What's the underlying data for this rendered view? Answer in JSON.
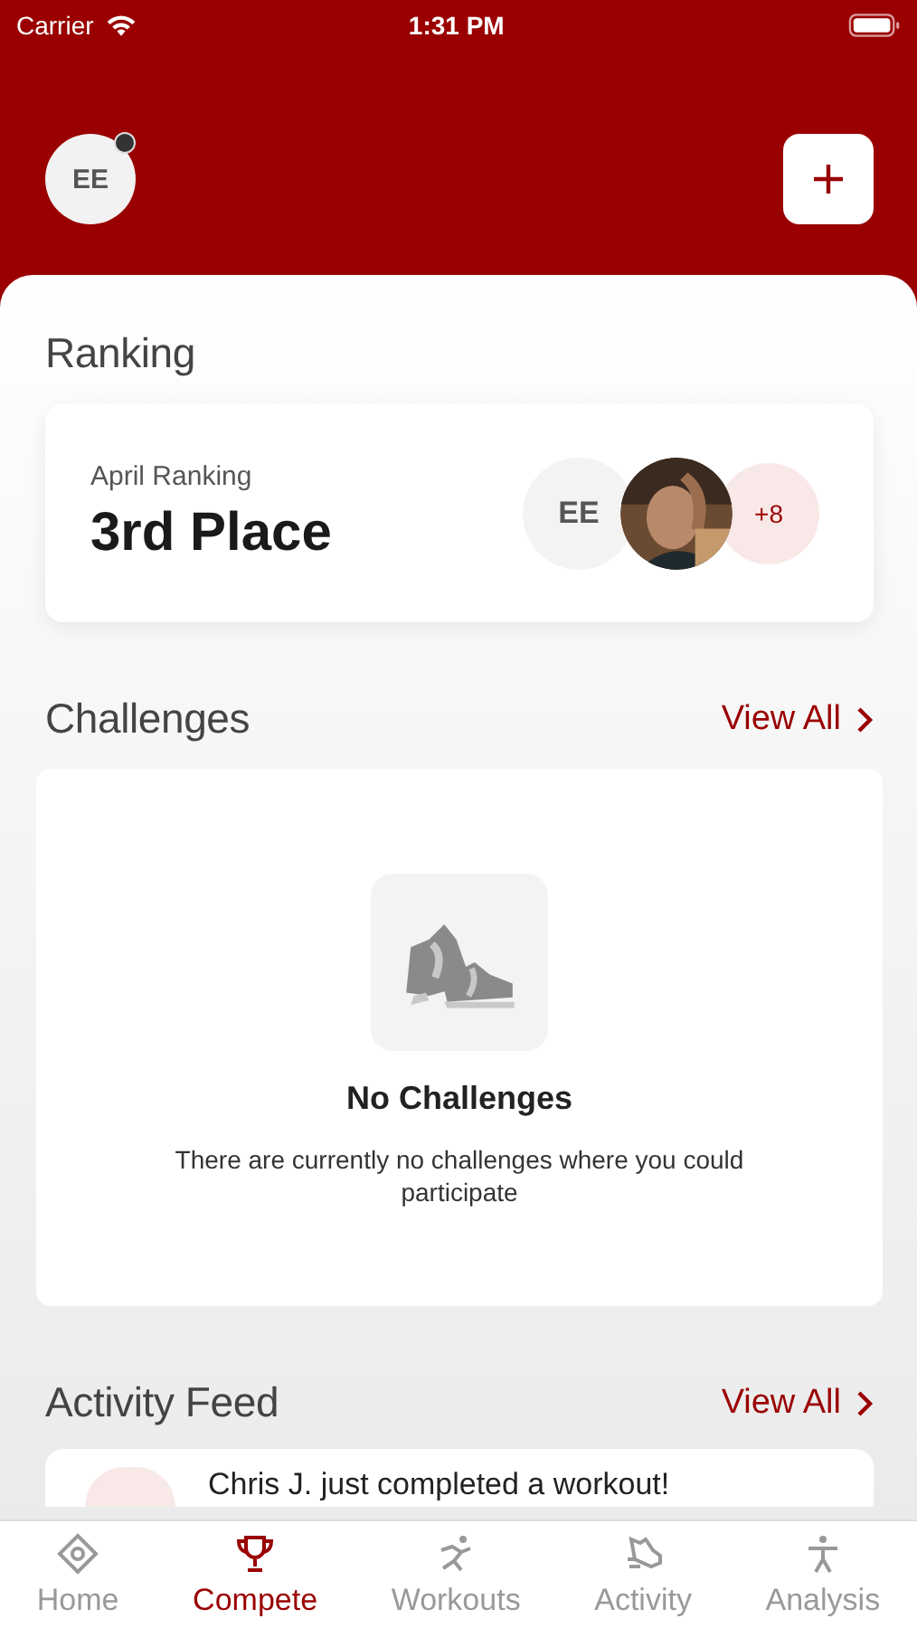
{
  "status_bar": {
    "carrier": "Carrier",
    "time": "1:31 PM"
  },
  "header": {
    "avatar": "EE",
    "notification_dot": true
  },
  "ranking": {
    "title": "Ranking",
    "label": "April Ranking",
    "place": "3rd Place",
    "participants": [
      {
        "kind": "initials",
        "text": "EE"
      },
      {
        "kind": "picture"
      },
      {
        "kind": "more",
        "text": "+8"
      }
    ]
  },
  "challenges": {
    "title": "Challenges",
    "view_all": "View All",
    "empty_title": "No Challenges",
    "empty_text": "There are currently no challenges where you could participate"
  },
  "activity_feed": {
    "title": "Activity Feed",
    "view_all": "View All",
    "items": [
      {
        "text": "Chris J. just completed a workout!"
      }
    ]
  },
  "tabs": [
    {
      "label": "Home",
      "selected": false
    },
    {
      "label": "Compete",
      "selected": true
    },
    {
      "label": "Workouts",
      "selected": false
    },
    {
      "label": "Activity",
      "selected": false
    },
    {
      "label": "Analysis",
      "selected": false
    }
  ]
}
